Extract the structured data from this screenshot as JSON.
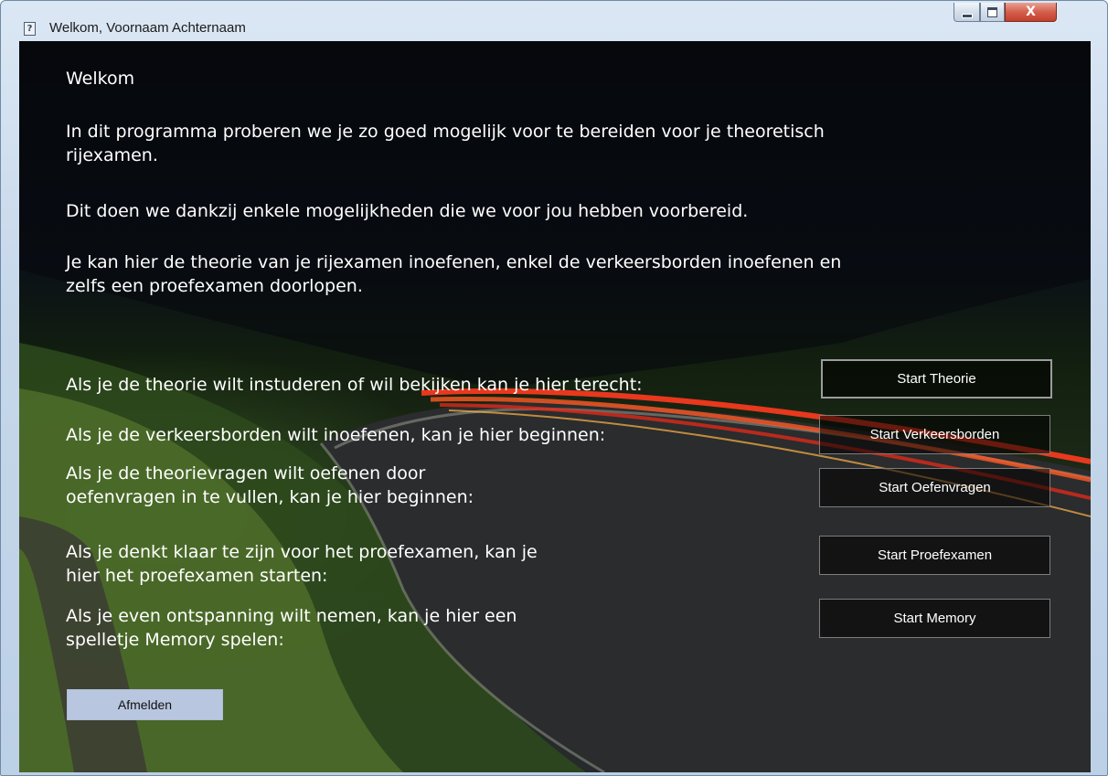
{
  "window": {
    "title": "Welkom, Voornaam Achternaam",
    "icon_glyph": "?",
    "minimize_glyph": "",
    "close_glyph": "X"
  },
  "content": {
    "heading": "Welkom",
    "paragraphs": [
      "In dit programma proberen we je zo goed mogelijk voor te bereiden voor je theoretisch\nrijexamen.",
      "Dit doen we dankzij enkele mogelijkheden die we voor jou hebben voorbereid.",
      "Je kan hier de theorie van je  rijexamen inoefenen, enkel de verkeersborden inoefenen en\nzelfs een proefexamen doorlopen."
    ],
    "rows": [
      {
        "label": "Als je de theorie wilt instuderen of wil bekijken kan je hier terecht:",
        "button": "Start Theorie"
      },
      {
        "label": "Als je de verkeersborden wilt inoefenen, kan je hier beginnen:",
        "button": "Start Verkeersborden"
      },
      {
        "label": "Als je de theorievragen wilt oefenen door\noefenvragen in te vullen, kan je hier beginnen:",
        "button": "Start Oefenvragen"
      },
      {
        "label": "Als je denkt klaar te zijn voor het proefexamen, kan je\nhier het proefexamen starten:",
        "button": "Start Proefexamen"
      },
      {
        "label": "Als je even ontspanning wilt nemen, kan je hier een\nspelletje Memory spelen:",
        "button": "Start Memory"
      }
    ],
    "logout_label": "Afmelden"
  },
  "icons": {
    "app": "app-icon",
    "minimize": "minimize-icon",
    "maximize": "maximize-icon",
    "close": "close-icon"
  },
  "colors": {
    "text": "#ffffff",
    "logout_button_bg": "#b9c6df",
    "light_trail": "#ff3b1f"
  }
}
